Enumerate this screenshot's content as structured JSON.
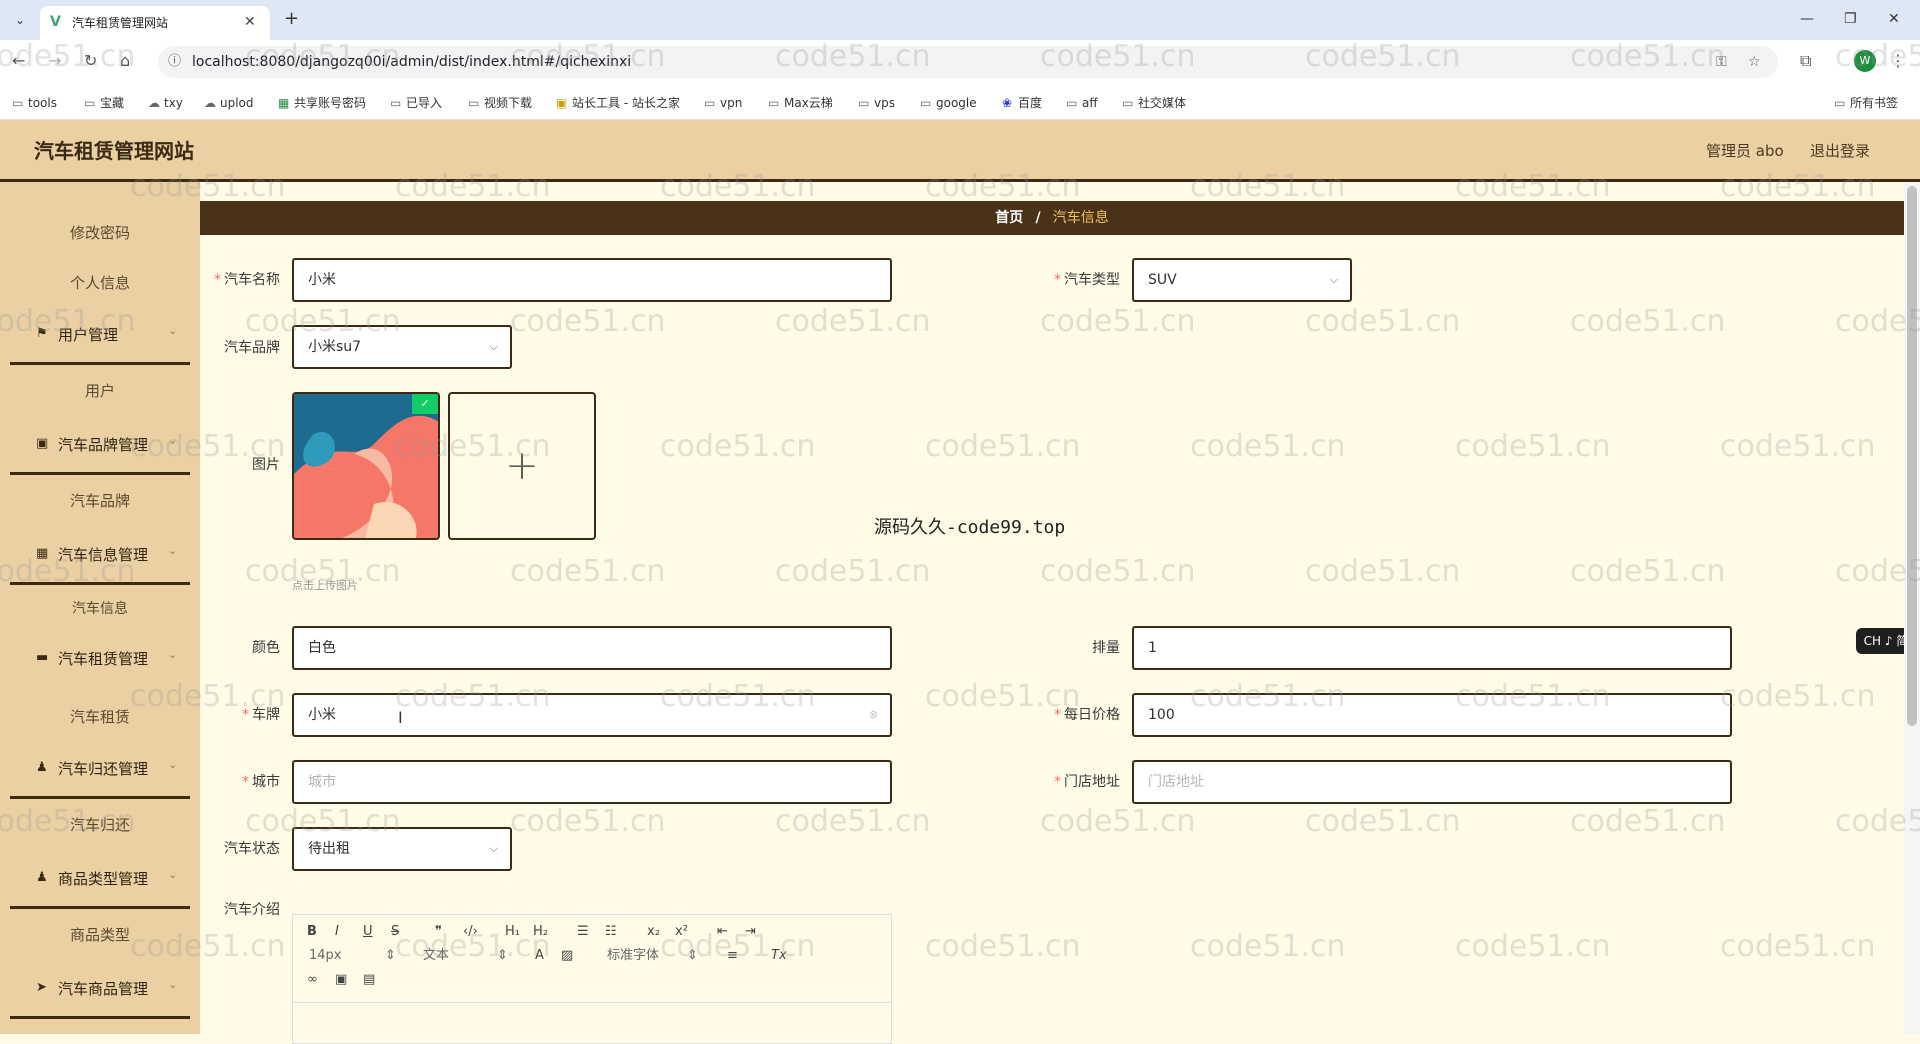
{
  "browser": {
    "tab_list_icon": "chevron-down-icon",
    "tab_title": "汽车租赁管理网站",
    "url": "localhost:8080/djangozq00i/admin/dist/index.html#/qichexinxi",
    "profile_initial": "W",
    "bookmarks": [
      {
        "label": "tools",
        "icon": "folder-icon"
      },
      {
        "label": "宝藏",
        "icon": "folder-icon"
      },
      {
        "label": "txy",
        "icon": "cloud-icon"
      },
      {
        "label": "uplod",
        "icon": "cloud-icon"
      },
      {
        "label": "共享账号密码",
        "icon": "sheet-icon"
      },
      {
        "label": "已导入",
        "icon": "folder-icon"
      },
      {
        "label": "视频下载",
        "icon": "folder-icon"
      },
      {
        "label": "站长工具 - 站长之家",
        "icon": "site-icon"
      },
      {
        "label": "vpn",
        "icon": "folder-icon"
      },
      {
        "label": "Max云梯",
        "icon": "folder-icon"
      },
      {
        "label": "vps",
        "icon": "folder-icon"
      },
      {
        "label": "google",
        "icon": "folder-icon"
      },
      {
        "label": "百度",
        "icon": "baidu-icon"
      },
      {
        "label": "aff",
        "icon": "folder-icon"
      },
      {
        "label": "社交媒体",
        "icon": "folder-icon"
      }
    ],
    "all_bookmarks": "所有书签"
  },
  "header": {
    "site_title": "汽车租赁管理网站",
    "admin_user": "管理员 abo",
    "logout": "退出登录"
  },
  "sidebar": {
    "sub_change_password": "修改密码",
    "sub_personal_info": "个人信息",
    "menu_user": "用户管理",
    "sub_user": "用户",
    "menu_brand": "汽车品牌管理",
    "sub_brand": "汽车品牌",
    "menu_carinfo": "汽车信息管理",
    "sub_carinfo": "汽车信息",
    "menu_rental": "汽车租赁管理",
    "sub_rental": "汽车租赁",
    "menu_return": "汽车归还管理",
    "sub_return": "汽车归还",
    "menu_goodstype": "商品类型管理",
    "sub_goodstype": "商品类型",
    "menu_goods": "汽车商品管理"
  },
  "breadcrumb": {
    "home": "首页",
    "separator": "/",
    "current": "汽车信息"
  },
  "form": {
    "car_name": {
      "label": "汽车名称",
      "value": "小米"
    },
    "car_type": {
      "label": "汽车类型",
      "value": "SUV"
    },
    "car_brand": {
      "label": "汽车品牌",
      "value": "小米su7"
    },
    "image": {
      "label": "图片",
      "tip": "点击上传图片"
    },
    "color": {
      "label": "颜色",
      "value": "白色"
    },
    "displacement": {
      "label": "排量",
      "value": "1"
    },
    "plate": {
      "label": "车牌",
      "value": "小米"
    },
    "daily_price": {
      "label": "每日价格",
      "value": "100"
    },
    "city": {
      "label": "城市",
      "placeholder": "城市"
    },
    "store_address": {
      "label": "门店地址",
      "placeholder": "门店地址"
    },
    "car_status": {
      "label": "汽车状态",
      "value": "待出租"
    },
    "intro": {
      "label": "汽车介绍"
    }
  },
  "editor": {
    "font_size": "14px",
    "heading_select": "文本",
    "font_family": "标准字体"
  },
  "overlay": {
    "center_watermark": "源码久久-code99.top",
    "ime_badge": "CH ♪ 简",
    "watermark_text": "code51.cn"
  },
  "colors": {
    "header_bg": "#ebd0a3",
    "breadcrumb_bg": "#4a3218",
    "content_bg": "#fffbe6",
    "required_star": "#f56c6c"
  }
}
